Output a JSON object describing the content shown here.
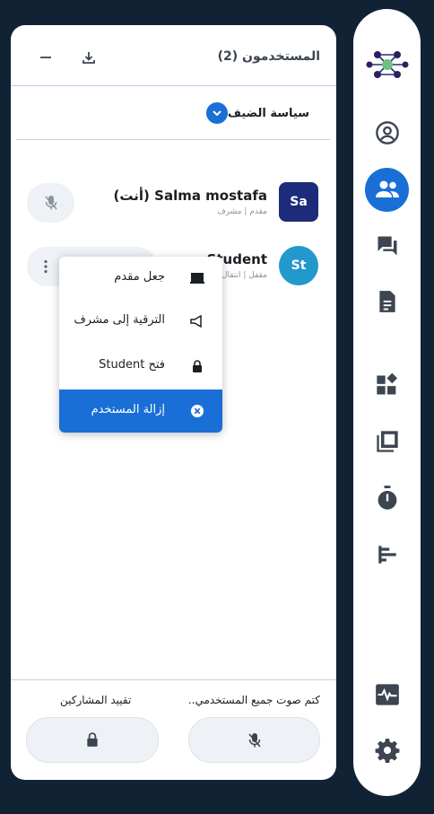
{
  "panel": {
    "title": "المستخدمون (2)",
    "minimize_icon": "minimize-icon",
    "download_icon": "download-icon",
    "policy_label": "سياسة الضيف"
  },
  "users": [
    {
      "initials": "Sa",
      "name": "Salma mostafa (أنت)",
      "role": "مقدم | مشرف",
      "avatar_color": "#1d2b7b"
    },
    {
      "initials": "St",
      "name": "Student",
      "role": "مقفل | انتقال",
      "avatar_color": "#2398cd"
    }
  ],
  "menu": {
    "items": [
      {
        "label": "جعل مقدم",
        "icon": "presentation-icon"
      },
      {
        "label": "الترقية إلى مشرف",
        "icon": "promote-icon"
      },
      {
        "label": "فتح Student",
        "icon": "lock-icon"
      },
      {
        "label": "إزالة المستخدم",
        "icon": "remove-circle-icon"
      }
    ]
  },
  "footer": {
    "mute_all_label": "كتم صوت جميع المستخدمي..",
    "lock_viewers_label": "تقييد المشاركين"
  },
  "colors": {
    "background": "#122235",
    "accent": "#1a6fd6",
    "icon": "#3c4550"
  },
  "rail_icons": [
    "app-logo-icon",
    "user-circle-icon",
    "users-icon",
    "chat-icon",
    "notes-icon",
    "apps-icon",
    "layers-icon",
    "timer-icon",
    "poll-icon",
    "activity-icon",
    "settings-icon"
  ]
}
